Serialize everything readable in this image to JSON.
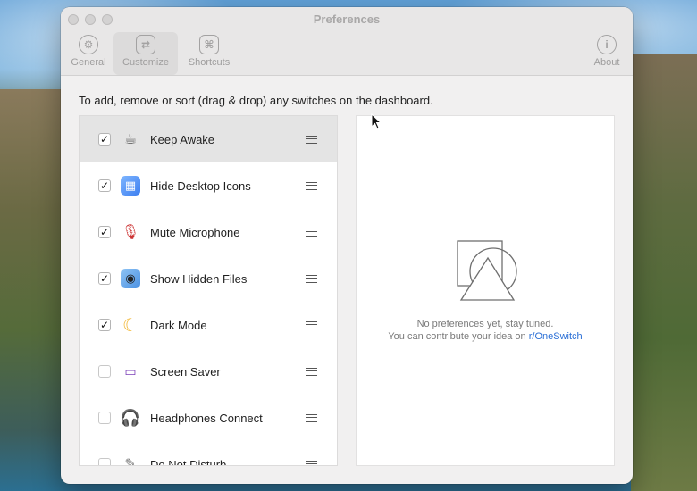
{
  "window": {
    "title": "Preferences"
  },
  "toolbar": {
    "items": [
      {
        "label": "General",
        "icon": "gear-icon",
        "glyph": "⚙",
        "selected": false
      },
      {
        "label": "Customize",
        "icon": "sliders-icon",
        "glyph": "⇄",
        "selected": true
      },
      {
        "label": "Shortcuts",
        "icon": "command-icon",
        "glyph": "⌘",
        "selected": false
      },
      {
        "label": "About",
        "icon": "info-icon",
        "glyph": "i",
        "selected": false
      }
    ]
  },
  "instructions": "To add, remove or sort (drag & drop) any switches on the dashboard.",
  "switches": [
    {
      "label": "Keep Awake",
      "checked": true,
      "icon": "coffee-cup-icon",
      "glyph": "☕"
    },
    {
      "label": "Hide Desktop Icons",
      "checked": true,
      "icon": "desktop-grid-icon",
      "glyph": "▦"
    },
    {
      "label": "Mute Microphone",
      "checked": true,
      "icon": "microphone-muted-icon",
      "glyph": "🎙"
    },
    {
      "label": "Show Hidden Files",
      "checked": true,
      "icon": "eye-icon",
      "glyph": "◉"
    },
    {
      "label": "Dark Mode",
      "checked": true,
      "icon": "moon-icon",
      "glyph": "☾"
    },
    {
      "label": "Screen Saver",
      "checked": false,
      "icon": "monitor-icon",
      "glyph": "▭"
    },
    {
      "label": "Headphones Connect",
      "checked": false,
      "icon": "headphones-icon",
      "glyph": "🎧"
    },
    {
      "label": "Do Not Disturb",
      "checked": false,
      "icon": "bell-slash-icon",
      "glyph": "✎"
    }
  ],
  "detail": {
    "empty_line1": "No preferences yet, stay tuned.",
    "empty_line2_prefix": "You can contribute your idea on ",
    "empty_link": "r/OneSwitch"
  }
}
